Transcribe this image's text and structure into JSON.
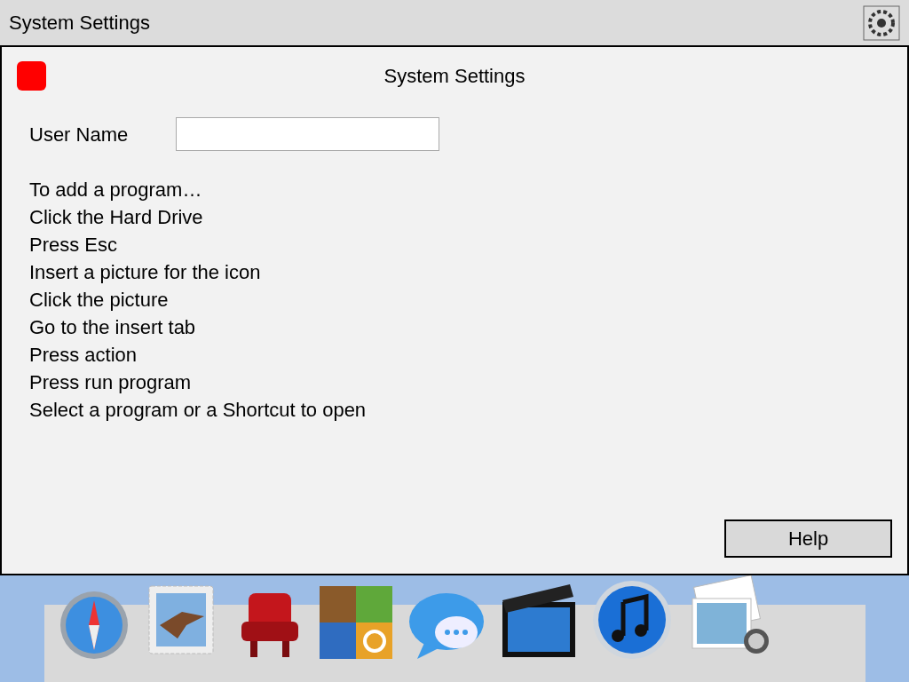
{
  "app_bar": {
    "title": "System Settings"
  },
  "window": {
    "title": "System Settings"
  },
  "form": {
    "label": "User Name"
  },
  "instructions": [
    "To add a program…",
    "Click the Hard Drive",
    "Press Esc",
    "Insert a picture for the icon",
    "Click the picture",
    "Go to the insert tab",
    "Press action",
    "Press run program",
    "Select a program or a Shortcut to open"
  ],
  "help_button": {
    "label": "Help"
  }
}
